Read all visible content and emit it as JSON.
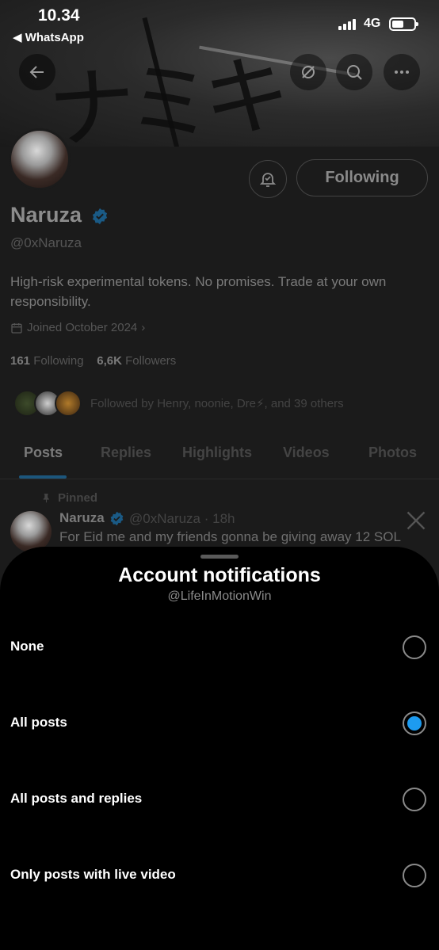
{
  "status_bar": {
    "time": "10.34",
    "back_app": "◀ WhatsApp",
    "network": "4G"
  },
  "banner": {
    "artwork_text": "ナミキ"
  },
  "profile": {
    "name": "Naruza",
    "handle": "@0xNaruza",
    "bio": "High-risk experimental tokens. No promises. Trade at your own responsibility.",
    "joined": "Joined October 2024",
    "following_count": "161",
    "following_label": "Following",
    "followers_count": "6,6K",
    "followers_label": "Followers",
    "followed_by": "Followed by Henry, noonie, Dre⚡, and 39 others",
    "follow_button": "Following"
  },
  "tabs": [
    "Posts",
    "Replies",
    "Highlights",
    "Videos",
    "Photos"
  ],
  "pinned_post": {
    "pinned_label": "Pinned",
    "author": "Naruza",
    "meta": "@0xNaruza · 18h",
    "text": "For Eid me and my friends gonna be giving away 12 SOL"
  },
  "sheet": {
    "title": "Account notifications",
    "subtitle": "@LifeInMotionWin",
    "options": [
      {
        "label": "None",
        "selected": false
      },
      {
        "label": "All posts",
        "selected": true
      },
      {
        "label": "All posts and replies",
        "selected": false
      },
      {
        "label": "Only posts with live video",
        "selected": false
      }
    ]
  },
  "colors": {
    "accent": "#1d9bf0",
    "sheet_background": "#000000",
    "profile_background_dimmed": "#1b1b1b"
  }
}
